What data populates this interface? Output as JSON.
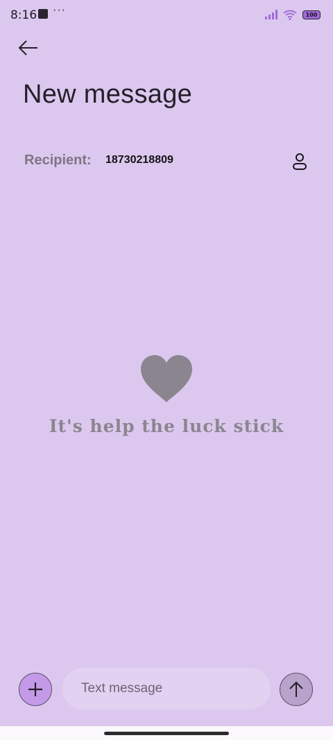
{
  "status_bar": {
    "time": "8:16",
    "more": "···",
    "battery": "100",
    "accent_color": "#a06ad8"
  },
  "header": {
    "back_icon": "arrow-left-icon",
    "title": "New message"
  },
  "recipient": {
    "label": "Recipient:",
    "value": "18730218809",
    "contact_icon": "person-icon"
  },
  "empty_state": {
    "icon": "heart-icon",
    "text": "It's help the luck stick"
  },
  "composer": {
    "attach_icon": "plus-icon",
    "placeholder": "Text message",
    "send_icon": "arrow-up-icon"
  },
  "colors": {
    "background": "#dcc8ee",
    "attach_button": "#c49ae8",
    "send_button": "#b9a3cb"
  }
}
